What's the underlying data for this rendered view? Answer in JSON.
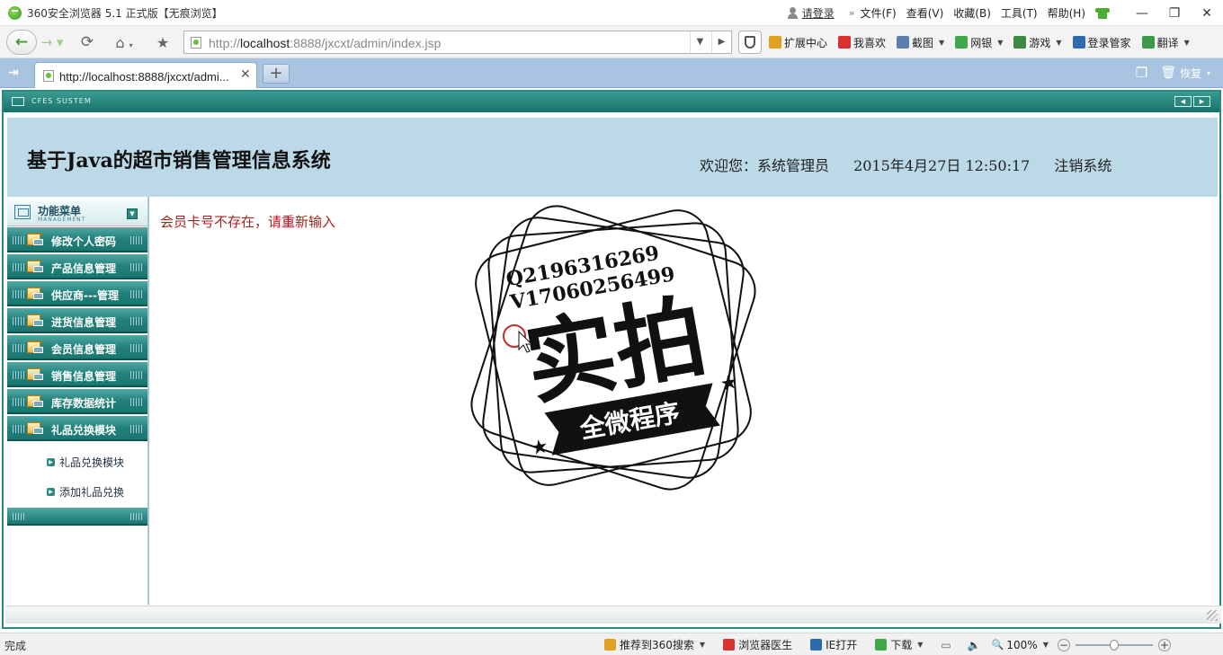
{
  "window": {
    "title": "360安全浏览器 5.1 正式版【无痕浏览】",
    "login_label": "请登录",
    "menu": [
      "文件(F)",
      "查看(V)",
      "收藏(B)",
      "工具(T)",
      "帮助(H)"
    ],
    "controls": {
      "minimize": "—",
      "restore": "❐",
      "close": "✕"
    }
  },
  "navbar": {
    "url_prefix": "http://",
    "url_host": "localhost",
    "url_rest": ":8888/jxcxt/admin/index.jsp",
    "toolbar": [
      {
        "label": "扩展中心",
        "icon": "extension-icon",
        "color": "#e0a020",
        "dropdown": false
      },
      {
        "label": "我喜欢",
        "icon": "heart-icon",
        "color": "#d93030",
        "dropdown": false
      },
      {
        "label": "截图",
        "icon": "screenshot-icon",
        "color": "#5a7fb0",
        "dropdown": true
      },
      {
        "label": "网银",
        "icon": "bank-icon",
        "color": "#3fa84a",
        "dropdown": true
      },
      {
        "label": "游戏",
        "icon": "game-icon",
        "color": "#3c8a40",
        "dropdown": true
      },
      {
        "label": "登录管家",
        "icon": "key-icon",
        "color": "#2d6ab0",
        "dropdown": false
      },
      {
        "label": "翻译",
        "icon": "translate-icon",
        "color": "#3c9a4a",
        "dropdown": true
      }
    ]
  },
  "tabs": {
    "active_tab_label": "http://localhost:8888/jxcxt/admi...",
    "restore_label": "恢复"
  },
  "page": {
    "system_label": "CFES SUSTEM",
    "title": "基于Java的超市销售管理信息系统",
    "welcome": "欢迎您：系统管理员",
    "datetime": "2015年4月27日  12:50:17",
    "logout": "注销系统",
    "menu_title": "功能菜单",
    "menu_subtitle": "MANAGEMENT",
    "menu_items": [
      "修改个人密码",
      "产品信息管理",
      "供应商---管理",
      "进货信息管理",
      "会员信息管理",
      "销售信息管理",
      "库存数据统计",
      "礼品兑换模块"
    ],
    "sub_items": [
      "礼品兑换模块",
      "添加礼品兑换"
    ],
    "error_message": "会员卡号不存在，请重新输入",
    "watermark": {
      "line1": "Q2196316269",
      "line2": "V17060256499",
      "big": "实拍",
      "banner": "全微程序"
    }
  },
  "statusbar": {
    "status": "完成",
    "items": [
      {
        "label": "推荐到360搜索",
        "icon": "recommend-icon",
        "color": "#e0a020",
        "dropdown": true
      },
      {
        "label": "浏览器医生",
        "icon": "doctor-icon",
        "color": "#d93030",
        "dropdown": false
      },
      {
        "label": "IE打开",
        "icon": "ie-icon",
        "color": "#2d6ab0",
        "dropdown": false
      },
      {
        "label": "下载",
        "icon": "download-icon",
        "color": "#3fa84a",
        "dropdown": true
      }
    ],
    "zoom": "100%"
  }
}
